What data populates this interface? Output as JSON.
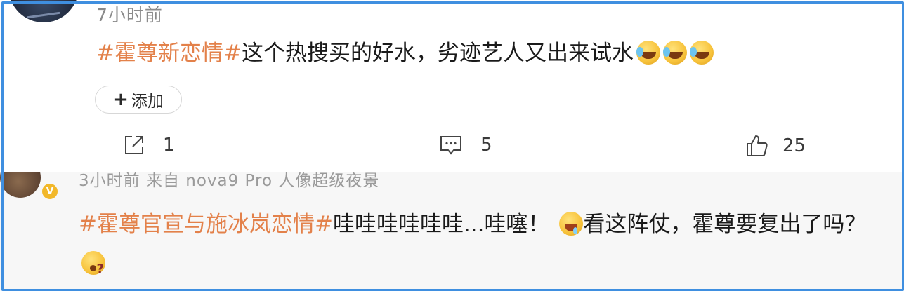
{
  "post1": {
    "timestamp": "7小时前",
    "hashtag": "#霍尊新恋情#",
    "text": "这个热搜买的好水，劣迹艺人又出来试水",
    "emojis": [
      "cry-laugh-emoji",
      "cry-laugh-emoji",
      "cry-laugh-emoji"
    ],
    "add_button_label": "添加",
    "add_button_plus": "+",
    "share_count": "1",
    "comment_count": "5",
    "like_count": "25"
  },
  "post2": {
    "meta": "3小时前 来自 nova9 Pro 人像超级夜景",
    "verified_badge": "V",
    "hashtag": "#霍尊官宣与施冰岚恋情#",
    "text_before_emoji": "哇哇哇哇哇哇...哇噻！",
    "text_after_emoji": "看这阵仗，霍尊要复出了吗？",
    "emojis": [
      "drool-emoji",
      "question-emoji"
    ]
  },
  "colors": {
    "hashtag": "#e3814a",
    "frame_border": "#3f8fe0",
    "verified_badge": "#f2b82a",
    "text": "#1a1a1a",
    "secondary_text": "#8a8a8a"
  }
}
